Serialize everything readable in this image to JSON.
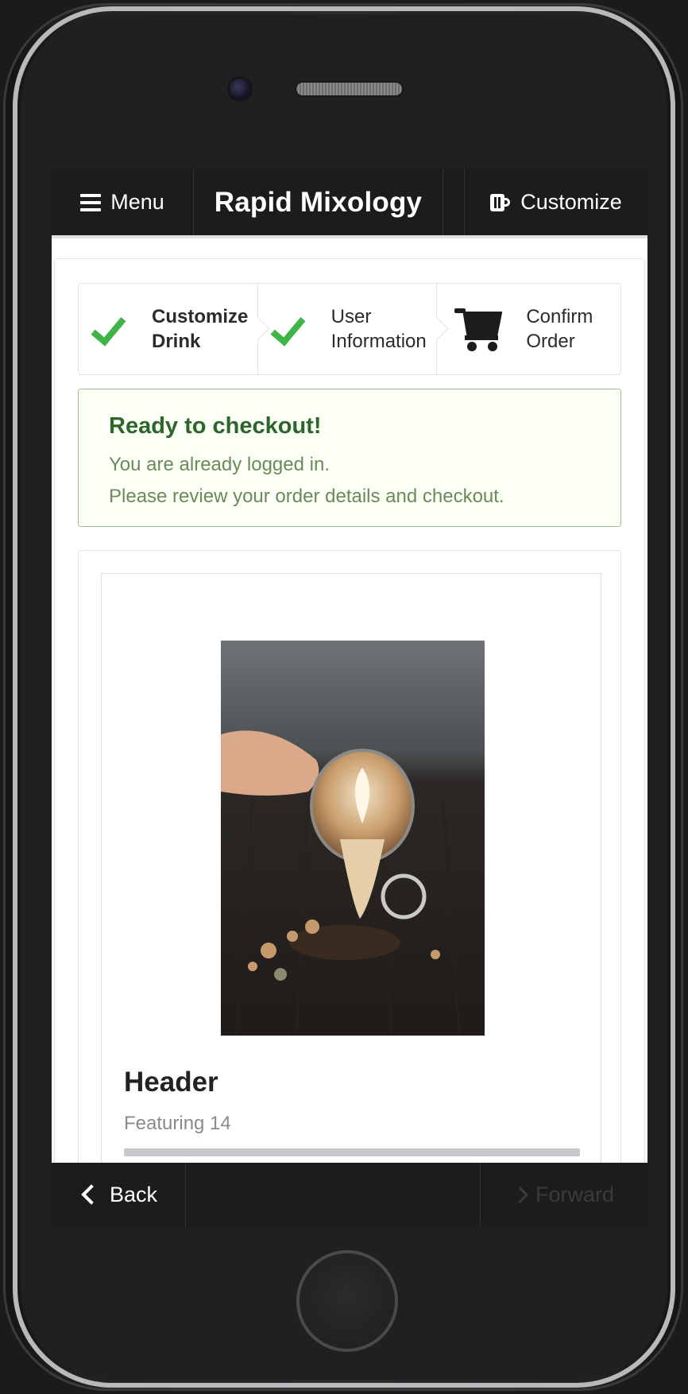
{
  "topbar": {
    "menu_label": "Menu",
    "brand": "Rapid Mixology",
    "customize_label": "Customize"
  },
  "steps": [
    {
      "label": "Customize\nDrink",
      "icon": "check-icon",
      "status": "completed"
    },
    {
      "label": "User\nInformation",
      "icon": "check-icon",
      "status": "completed"
    },
    {
      "label": "Confirm\nOrder",
      "icon": "cart-icon",
      "status": "active"
    }
  ],
  "alert": {
    "title": "Ready to checkout!",
    "line1": "You are already logged in.",
    "line2": "Please review your order details and checkout."
  },
  "card": {
    "image": "latte-art-spill-photo",
    "title": "Header",
    "meta": "Featuring 14"
  },
  "bottombar": {
    "back_label": "Back",
    "forward_label": "Forward"
  },
  "colors": {
    "nav_bg": "#1b1c1d",
    "check": "#3fb548",
    "alert_bg": "#fcfff5",
    "alert_border": "#a3c293",
    "alert_title": "#2c662d"
  }
}
